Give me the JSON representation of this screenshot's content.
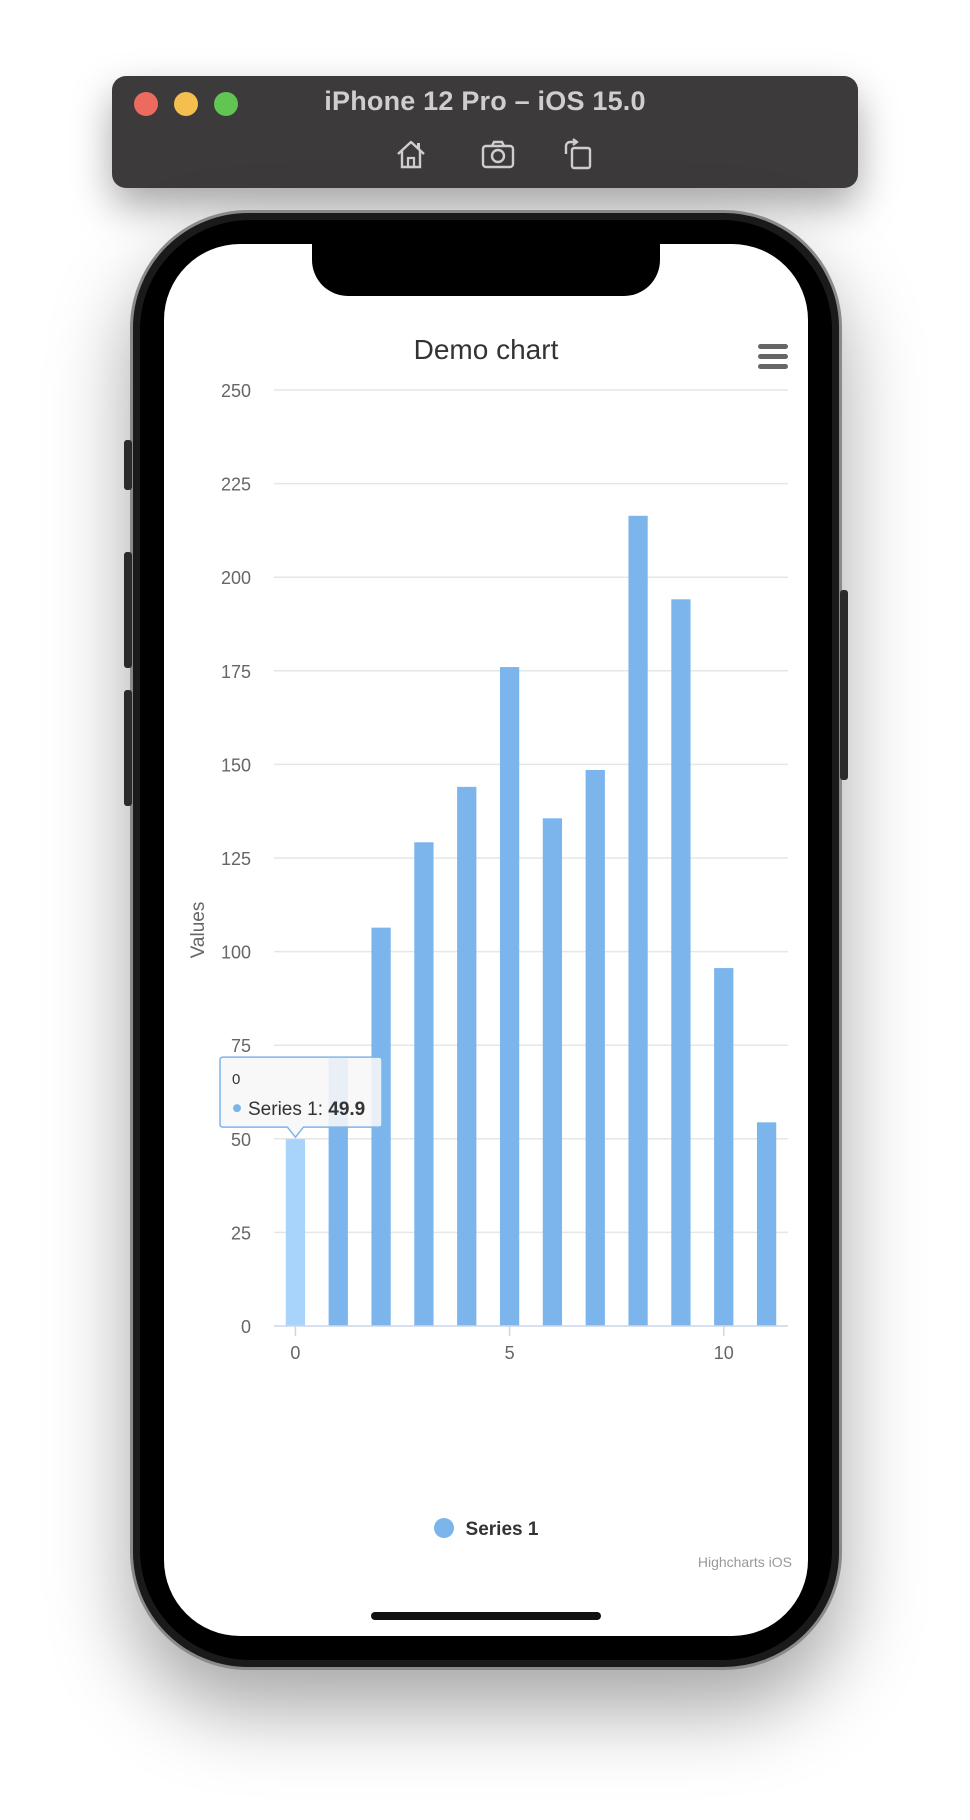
{
  "window": {
    "title": "iPhone 12 Pro – iOS 15.0",
    "toolbar": [
      {
        "name": "home-icon",
        "label": "Home"
      },
      {
        "name": "screenshot-icon",
        "label": "Screenshot"
      },
      {
        "name": "rotate-icon",
        "label": "Rotate"
      }
    ]
  },
  "colors": {
    "series": "#7cb5ec",
    "series_hover": "#a8d3fb",
    "gridline": "#e6e6e6",
    "axis_text": "#666666",
    "title_text": "#333333",
    "titlebar": "#3d3a3c",
    "close": "#ed6a5e",
    "minimize": "#f5bf4f",
    "zoom": "#61c554"
  },
  "menu": {
    "icon": "hamburger-icon"
  },
  "credits": "Highcharts iOS",
  "tooltip": {
    "header": "0",
    "series_label": "Series 1: ",
    "value_label": "49.9"
  },
  "chart_data": {
    "type": "bar",
    "title": "Demo chart",
    "ylabel": "Values",
    "xlabel": "",
    "x": [
      0,
      1,
      2,
      3,
      4,
      5,
      6,
      7,
      8,
      9,
      10,
      11
    ],
    "xticks": [
      0,
      5,
      10
    ],
    "yticks": [
      0,
      25,
      50,
      75,
      100,
      125,
      150,
      175,
      200,
      225,
      250
    ],
    "ylim": [
      0,
      250
    ],
    "xlim": [
      -0.5,
      11.5
    ],
    "grid": true,
    "legend": "bottom-center",
    "series": [
      {
        "name": "Series 1",
        "values": [
          49.9,
          71.5,
          106.4,
          129.2,
          144.0,
          176.0,
          135.6,
          148.5,
          216.4,
          194.1,
          95.6,
          54.4
        ]
      }
    ],
    "hovered_index": 0
  }
}
